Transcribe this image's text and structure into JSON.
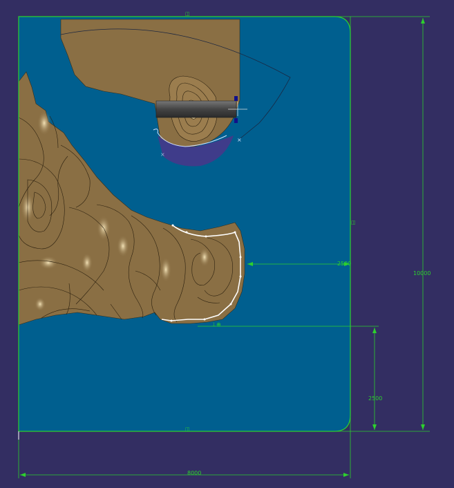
{
  "viewport": {
    "background_color": "#332e62",
    "sea_color": "#005f8f",
    "land_color": "#8a6f44",
    "constraint_color": "#2dd12d"
  },
  "dimensions": {
    "height": "10000",
    "width": "8000",
    "bottom_offset": "2500",
    "right_offset": "2500"
  }
}
